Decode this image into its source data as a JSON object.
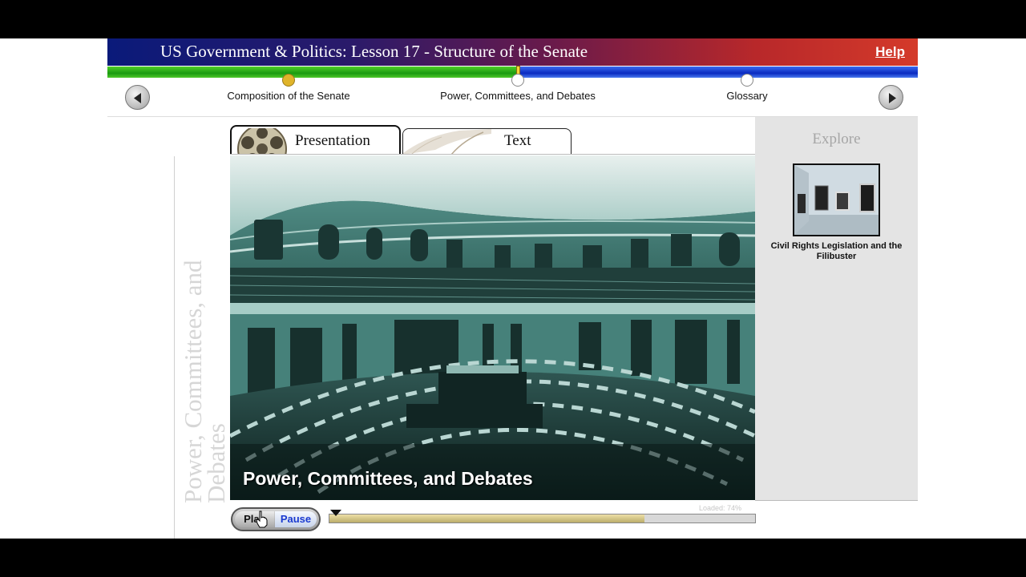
{
  "header": {
    "title": "US Government & Politics: Lesson 17 -  Structure of the Senate",
    "help_label": "Help"
  },
  "nav": {
    "sections": [
      {
        "label": "Composition of the Senate",
        "state": "visited"
      },
      {
        "label": "Power, Committees, and Debates",
        "state": "current"
      },
      {
        "label": "Glossary",
        "state": "unvisited"
      }
    ],
    "prev_icon": "left-arrow-icon",
    "next_icon": "right-arrow-icon"
  },
  "section_title": "Power, Committees, and Debates",
  "tabs": {
    "presentation_label": "Presentation",
    "text_label": "Text",
    "active": "Presentation"
  },
  "video": {
    "caption": "Power, Committees, and Debates"
  },
  "explore": {
    "title": "Explore",
    "items": [
      {
        "caption": "Civil Rights Legislation and the Filibuster"
      }
    ]
  },
  "player": {
    "play_label": "Play",
    "pause_label": "Pause",
    "progress": 0.74,
    "loaded_text": "Loaded: 74%"
  },
  "colors": {
    "title_gradient_start": "#0a1a7a",
    "title_gradient_end": "#d43a2a",
    "progress_green": "#1a9a10",
    "progress_blue": "#0a2ac0",
    "visited_dot": "#e0b42a",
    "video_tint": "#1d3b38"
  }
}
